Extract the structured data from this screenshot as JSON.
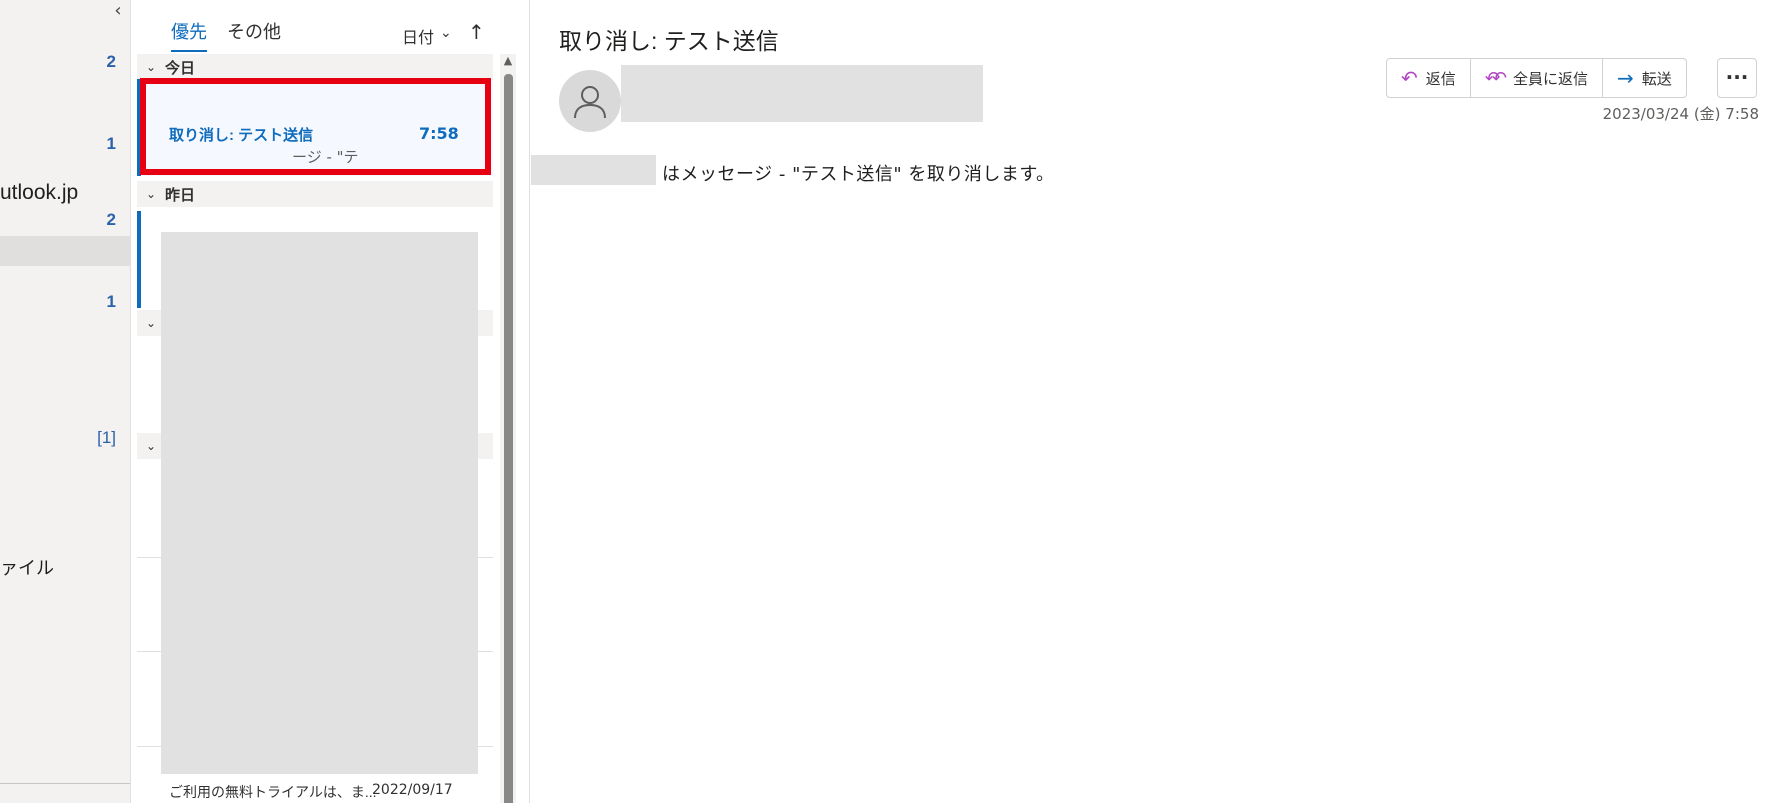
{
  "folder_pane": {
    "collapse_icon": "‹",
    "counts": [
      "2",
      "1",
      "2",
      "1",
      "[1]"
    ],
    "account_text": "utlook.jp",
    "file_text": "ァイル"
  },
  "message_list": {
    "tabs": [
      {
        "label": "優先",
        "active": true
      },
      {
        "label": "その他",
        "active": false
      }
    ],
    "sort_label": "日付",
    "sort_chevron": "⌄",
    "sort_direction_icon": "↑",
    "groups": [
      {
        "label": "今日"
      },
      {
        "label": "昨日"
      }
    ],
    "collapsed_group_chevron": "⌄",
    "selected_message": {
      "subject": "取り消し: テスト送信",
      "time": "7:58",
      "preview": "ージ - \"テ"
    },
    "last_message": {
      "preview": "ご利用の無料トライアルは、ま...",
      "date": "2022/09/17"
    },
    "scroll_up_icon": "▲"
  },
  "reading_pane": {
    "subject": "取り消し: テスト送信",
    "actions": [
      {
        "label": "返信",
        "icon": "↶",
        "icon_color": "#b146c2"
      },
      {
        "label": "全員に返信",
        "icon": "↶↶",
        "icon_color": "#b146c2"
      },
      {
        "label": "転送",
        "icon": "→",
        "icon_color": "#0f6cbd"
      }
    ],
    "more_icon": "···",
    "date": "2023/03/24 (金) 7:58",
    "body": "はメッセージ - \"テスト送信\" を取り消します。"
  },
  "colors": {
    "accent": "#0f6cbd",
    "highlight_box": "#e60012",
    "redaction": "#e1e1e1"
  }
}
